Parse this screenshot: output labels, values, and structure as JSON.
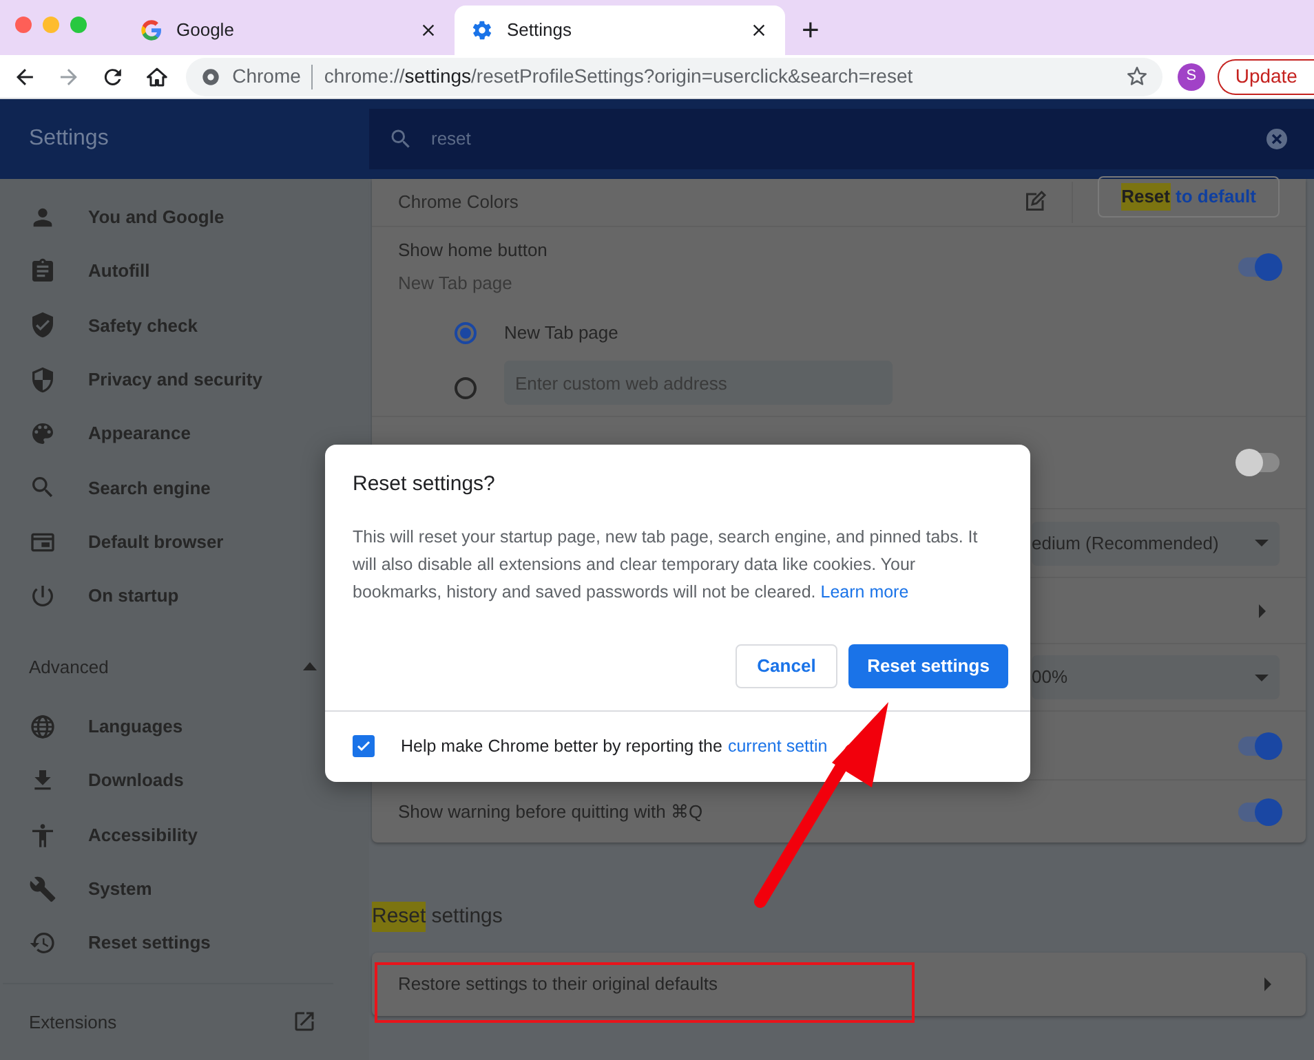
{
  "browser": {
    "tabs": [
      {
        "title": "Google",
        "selected": false
      },
      {
        "title": "Settings",
        "selected": true
      }
    ],
    "new_tab": "+",
    "omnibox": {
      "site_label": "Chrome",
      "url": "chrome://**settings**/resetProfileSettings?origin=userclick&search=reset"
    },
    "avatar": "S",
    "update_button": "Update"
  },
  "header": {
    "title": "Settings",
    "search": {
      "value": "reset"
    }
  },
  "sidebar": {
    "items": [
      {
        "label": "You and Google",
        "selected": false
      },
      {
        "label": "Autofill",
        "selected": false
      },
      {
        "label": "Safety check",
        "selected": false
      },
      {
        "label": "Privacy and security",
        "selected": false
      },
      {
        "label": "Appearance",
        "selected": false
      },
      {
        "label": "Search engine",
        "selected": false
      },
      {
        "label": "Default browser",
        "selected": false
      },
      {
        "label": "On startup",
        "selected": false
      }
    ],
    "advanced": {
      "label": "Advanced",
      "expanded": true
    },
    "advanced_items": [
      {
        "label": "Languages",
        "selected": false
      },
      {
        "label": "Downloads",
        "selected": false
      },
      {
        "label": "Accessibility",
        "selected": false
      },
      {
        "label": "System",
        "selected": false
      },
      {
        "label": "Reset settings",
        "selected": false
      }
    ],
    "extensions": "Extensions"
  },
  "content": {
    "rows": [
      {
        "kind": "action",
        "label": "Chrome Colors",
        "button": {
          "highlight": "Reset",
          "rest": "to default"
        }
      },
      {
        "kind": "toggle",
        "label": "Show home button",
        "sublabel": "New Tab page",
        "on": true
      },
      {
        "kind": "radio",
        "label": "New Tab page",
        "selected": true
      },
      {
        "kind": "radio_input",
        "placeholder": "Enter custom web address",
        "selected": false
      },
      {
        "kind": "toggle",
        "on": false
      },
      {
        "kind": "dropdown",
        "value": "edium (Recommended)"
      },
      {
        "kind": "link"
      },
      {
        "kind": "dropdown",
        "value": "00%"
      },
      {
        "kind": "toggle",
        "on": true
      },
      {
        "kind": "toggle",
        "label": "Show warning before quitting with ⌘Q",
        "on": true
      }
    ],
    "reset_section": {
      "heading": {
        "highlight": "Reset",
        "rest": "settings"
      },
      "rows": [
        {
          "kind": "link",
          "label": "Restore settings to their original defaults"
        }
      ]
    }
  },
  "dialog": {
    "title": "Reset settings?",
    "body": "This will reset your startup page, new tab page, search engine, and pinned tabs. It will also disable all extensions and clear temporary data like cookies. Your bookmarks, history and saved passwords will not be cleared.",
    "body_link": "Learn more",
    "cancel": "Cancel",
    "confirm": "Reset settings",
    "checkbox": {
      "checked": true,
      "label": "Help make Chrome better by reporting the",
      "link": "current settin"
    }
  }
}
